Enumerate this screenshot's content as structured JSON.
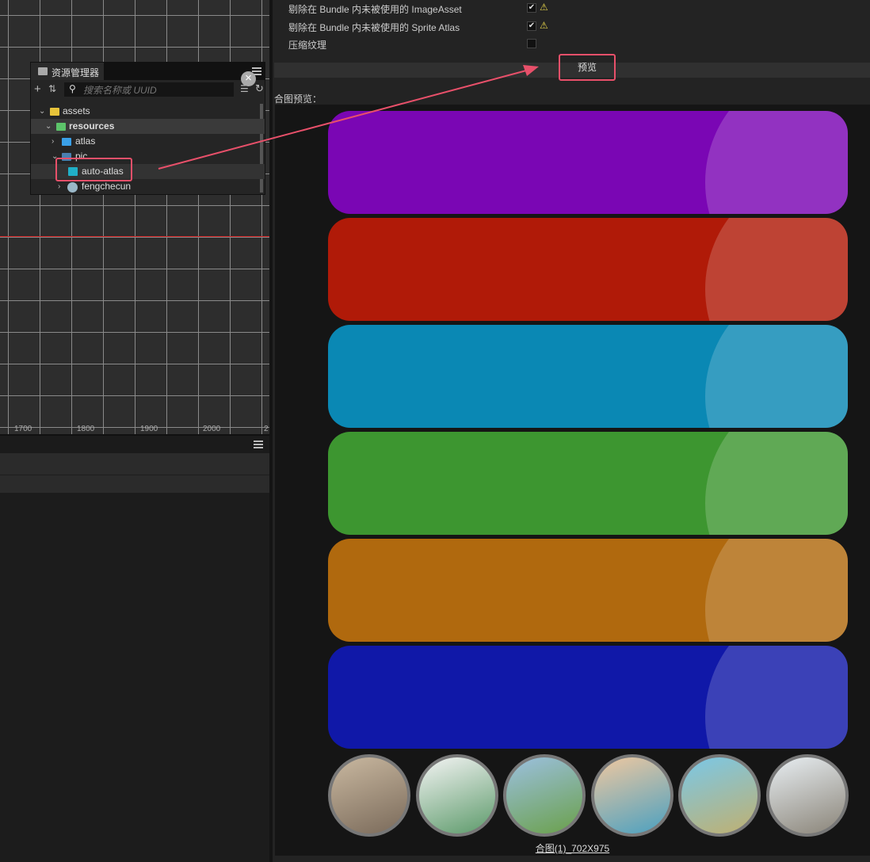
{
  "scene": {
    "ruler_ticks": [
      "1700",
      "1800",
      "1900",
      "2000",
      "2"
    ]
  },
  "assets_panel": {
    "title": "资源管理器",
    "search_placeholder": "搜索名称或 UUID",
    "tree": [
      {
        "label": "assets",
        "icon": "database-icon",
        "expanded": true
      },
      {
        "label": "resources",
        "icon": "folder-open-icon",
        "expanded": true,
        "selected": true
      },
      {
        "label": "atlas",
        "icon": "folder-icon",
        "expanded": false
      },
      {
        "label": "pic",
        "icon": "folder-open-icon",
        "expanded": true
      },
      {
        "label": "auto-atlas",
        "icon": "auto-atlas-icon",
        "highlighted": true
      },
      {
        "label": "fengchecun",
        "icon": "prefab-icon",
        "expanded": false
      }
    ]
  },
  "inspector": {
    "options": [
      {
        "label": "剔除在 Bundle 内未被使用的 ImageAsset",
        "checked": true,
        "warning": true
      },
      {
        "label": "剔除在 Bundle 内未被使用的 Sprite Atlas",
        "checked": true,
        "warning": true
      },
      {
        "label": "压缩纹理",
        "checked": false,
        "warning": false
      }
    ],
    "preview_button": "预览",
    "preview_label": "合图预览：",
    "atlas_caption": "合图(1)_702X975",
    "bar_colors": [
      "#7a06b4",
      "#b01a08",
      "#0a88b4",
      "#3d9630",
      "#b0690e",
      "#1018a8"
    ],
    "thumbnail_subjects": [
      "cafe-terrace",
      "pagoda",
      "windmill",
      "father-child-walk",
      "seaside-cliff",
      "cathedral"
    ]
  },
  "colors": {
    "highlight": "#e8506a",
    "grid_red_line": "#d02020"
  }
}
